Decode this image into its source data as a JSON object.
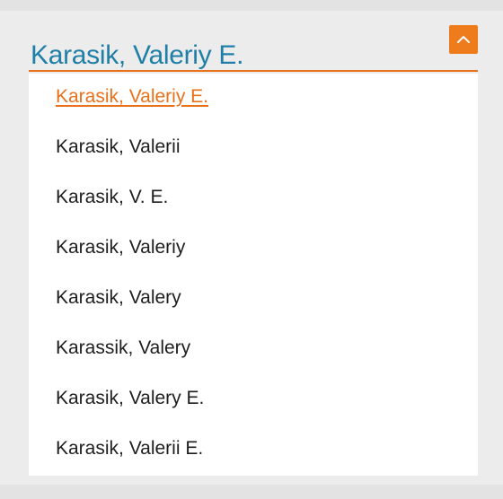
{
  "combobox": {
    "value": "Karasik, Valeriy E.",
    "toggle_icon": "chevron-up-icon",
    "accent_color": "#e8711a",
    "value_color": "#1f7fa6"
  },
  "options": [
    {
      "label": "Karasik, Valeriy E.",
      "selected": true
    },
    {
      "label": "Karasik, Valerii",
      "selected": false
    },
    {
      "label": "Karasik, V. E.",
      "selected": false
    },
    {
      "label": "Karasik, Valeriy",
      "selected": false
    },
    {
      "label": "Karasik, Valery",
      "selected": false
    },
    {
      "label": "Karassik, Valery",
      "selected": false
    },
    {
      "label": "Karasik, Valery E.",
      "selected": false
    },
    {
      "label": "Karasik, Valerii E.",
      "selected": false
    }
  ]
}
